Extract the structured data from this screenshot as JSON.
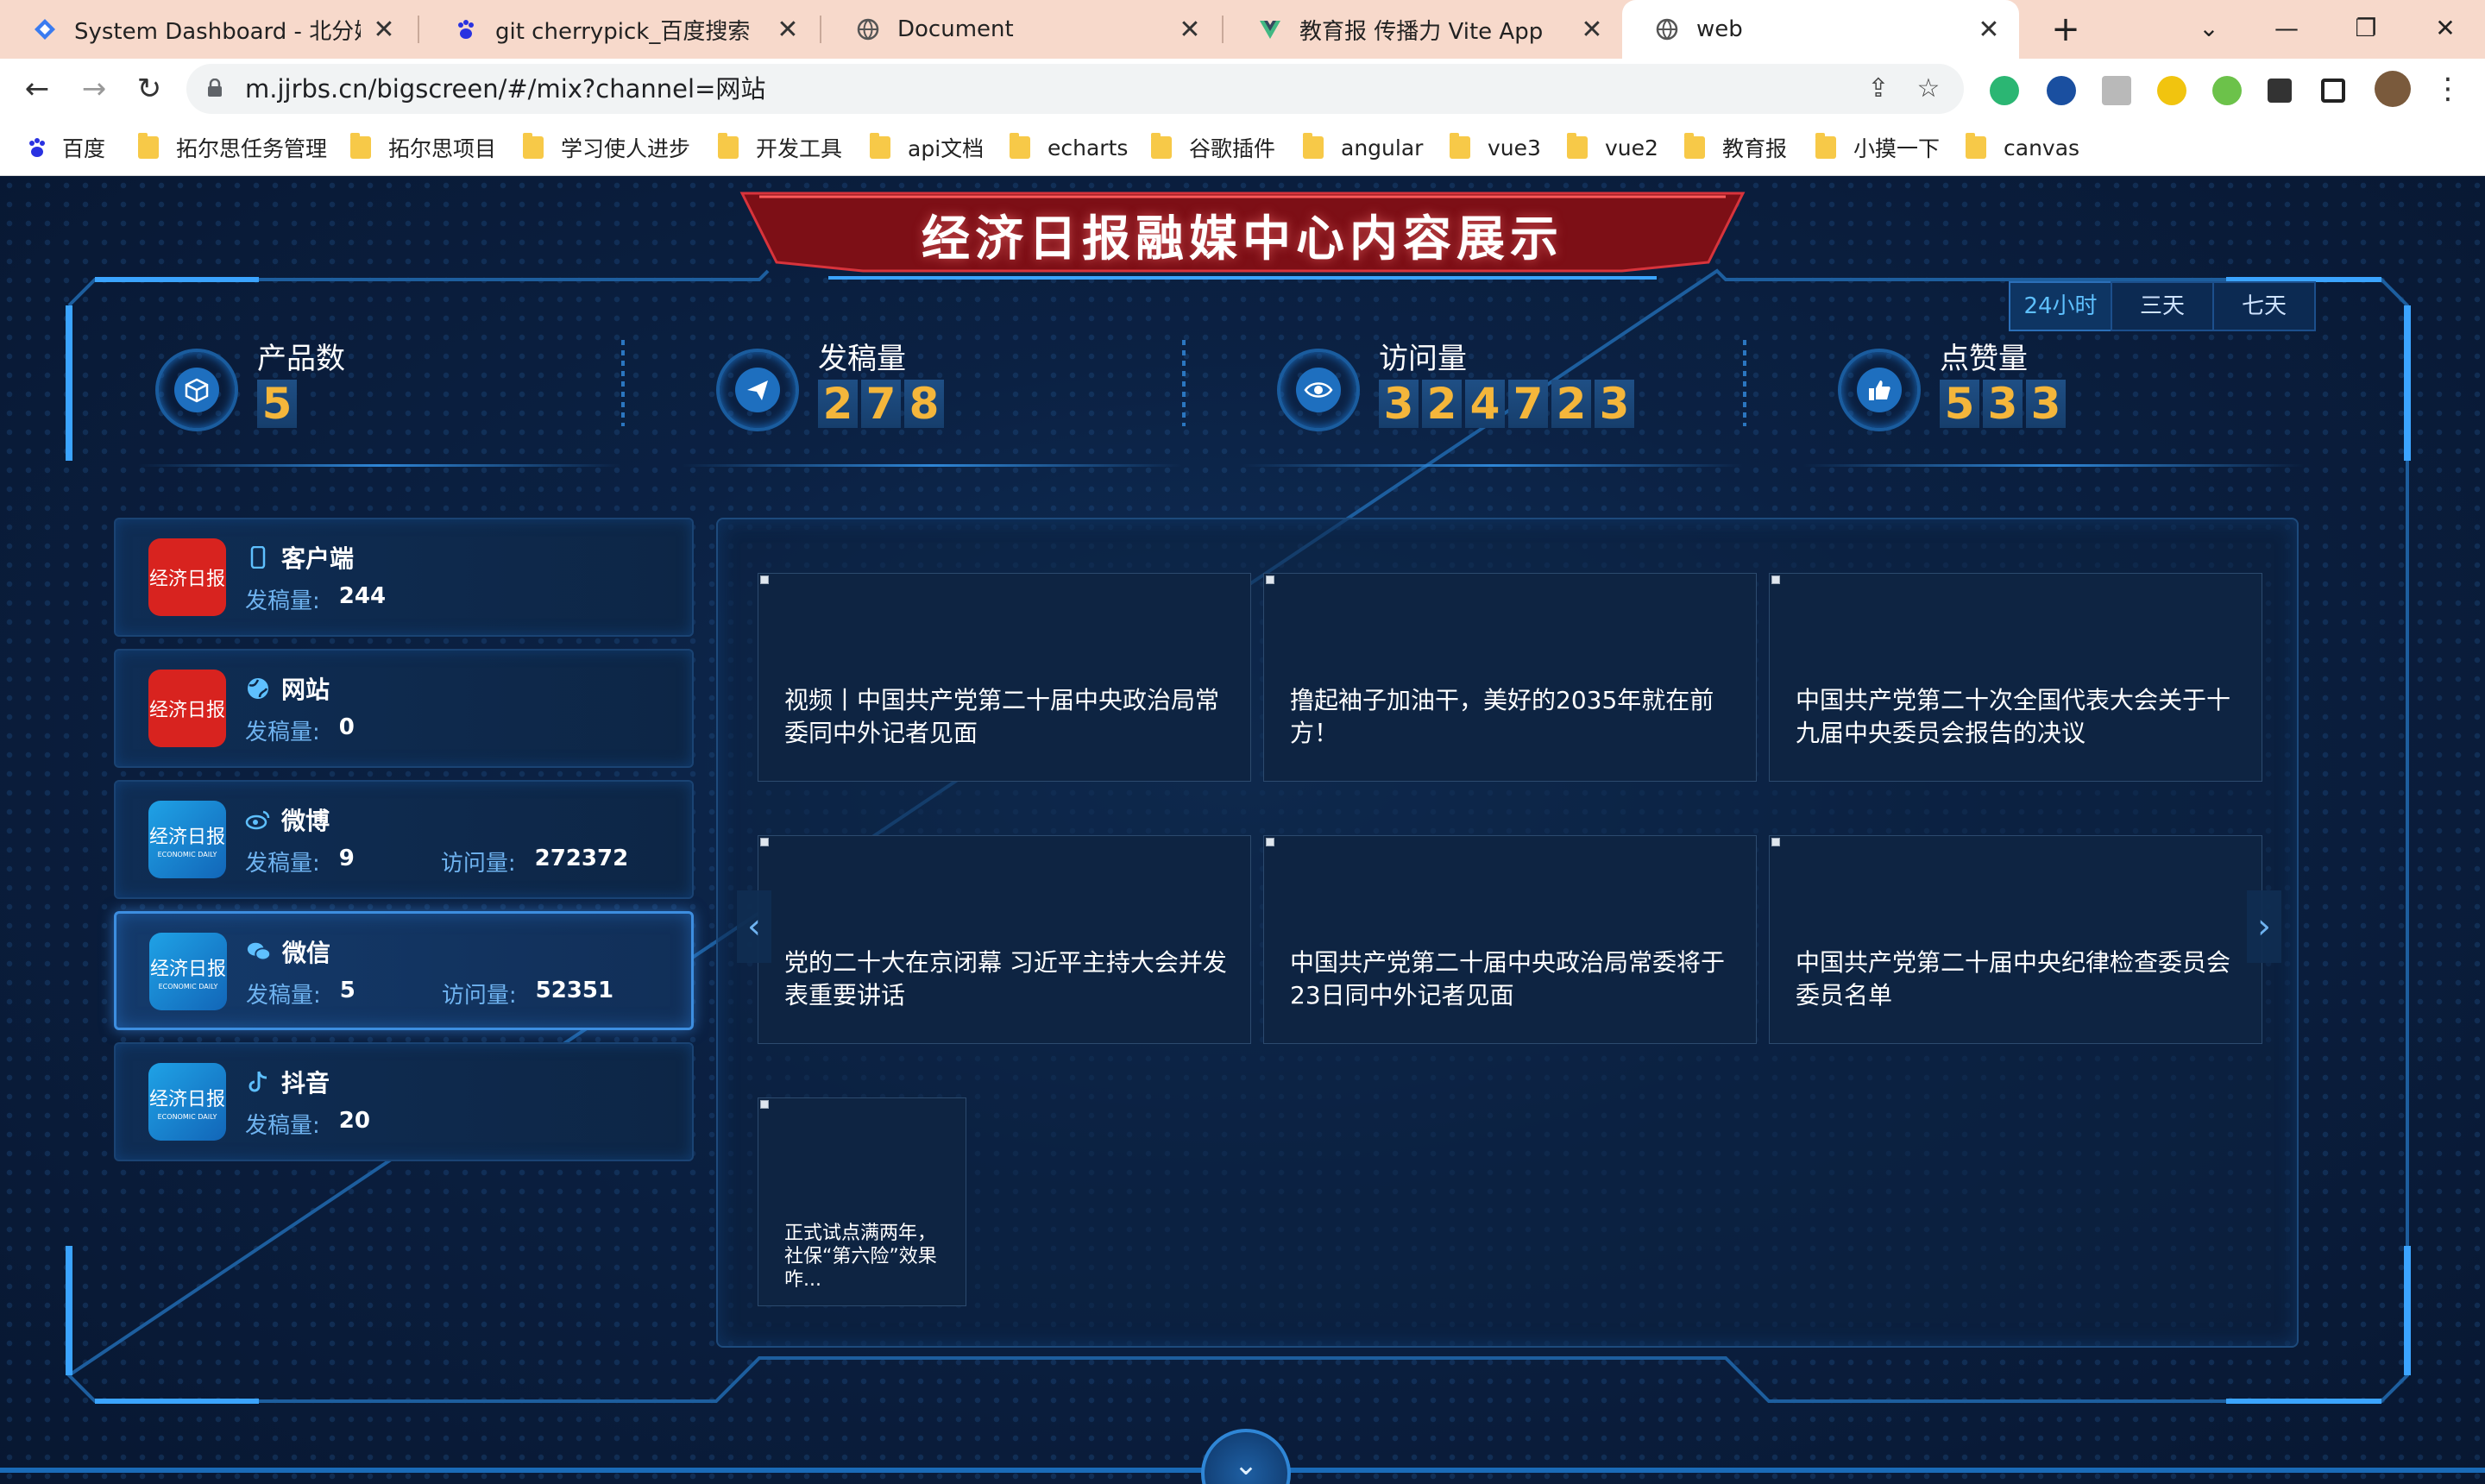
{
  "browser": {
    "tabs": [
      {
        "label": "System Dashboard - 北分媒体",
        "icon": "diamond-icon"
      },
      {
        "label": "git cherrypick_百度搜索",
        "icon": "baidu-paw-icon"
      },
      {
        "label": "Document",
        "icon": "globe-icon"
      },
      {
        "label": "教育报 传播力 Vite App",
        "icon": "vue-icon"
      },
      {
        "label": "web",
        "icon": "globe-icon"
      }
    ],
    "active_tab": 4,
    "url": "m.jjrbs.cn/bigscreen/#/mix?channel=网站",
    "bookmarks": [
      "百度",
      "拓尔思任务管理",
      "拓尔思项目",
      "学习使人进步",
      "开发工具",
      "api文档",
      "echarts",
      "谷歌插件",
      "angular",
      "vue3",
      "vue2",
      "教育报",
      "小摸一下",
      "canvas"
    ]
  },
  "dashboard": {
    "title": "经济日报融媒中心内容展示",
    "ranges": [
      "24小时",
      "三天",
      "七天"
    ],
    "active_range": 0,
    "stats": [
      {
        "label": "产品数",
        "value": "5",
        "icon": "cube-icon"
      },
      {
        "label": "发稿量",
        "value": "278",
        "icon": "paper-plane-icon"
      },
      {
        "label": "访问量",
        "value": "324723",
        "icon": "eye-icon"
      },
      {
        "label": "点赞量",
        "value": "533",
        "icon": "thumbs-up-icon"
      }
    ],
    "channels": [
      {
        "name": "客户端",
        "icon": "phone-icon",
        "logo": "red",
        "posts_label": "发稿量:",
        "posts": "244"
      },
      {
        "name": "网站",
        "icon": "globe-icon",
        "logo": "red",
        "posts_label": "发稿量:",
        "posts": "0"
      },
      {
        "name": "微博",
        "icon": "weibo-icon",
        "logo": "blue",
        "posts_label": "发稿量:",
        "posts": "9",
        "visits_label": "访问量:",
        "visits": "272372"
      },
      {
        "name": "微信",
        "icon": "wechat-icon",
        "logo": "blue",
        "posts_label": "发稿量:",
        "posts": "5",
        "visits_label": "访问量:",
        "visits": "52351"
      },
      {
        "name": "抖音",
        "icon": "tiktok-icon",
        "logo": "blue",
        "posts_label": "发稿量:",
        "posts": "20"
      }
    ],
    "active_channel": 3,
    "logo_text": "经济日报",
    "logo_en": "ECONOMIC DAILY",
    "articles": [
      "视频丨中国共产党第二十届中央政治局常委同中外记者见面",
      "撸起袖子加油干，美好的2035年就在前方！",
      "中国共产党第二十次全国代表大会关于十九届中央委员会报告的决议",
      "党的二十大在京闭幕 习近平主持大会并发表重要讲话",
      "中国共产党第二十届中央政治局常委将于23日同中外记者见面",
      "中国共产党第二十届中央纪律检查委员会委员名单",
      "正式试点满两年，社保“第六险”效果咋..."
    ],
    "colors": {
      "digit": "#f4b63b",
      "accent": "#2f86d6",
      "title_red": "#b8141c"
    }
  }
}
